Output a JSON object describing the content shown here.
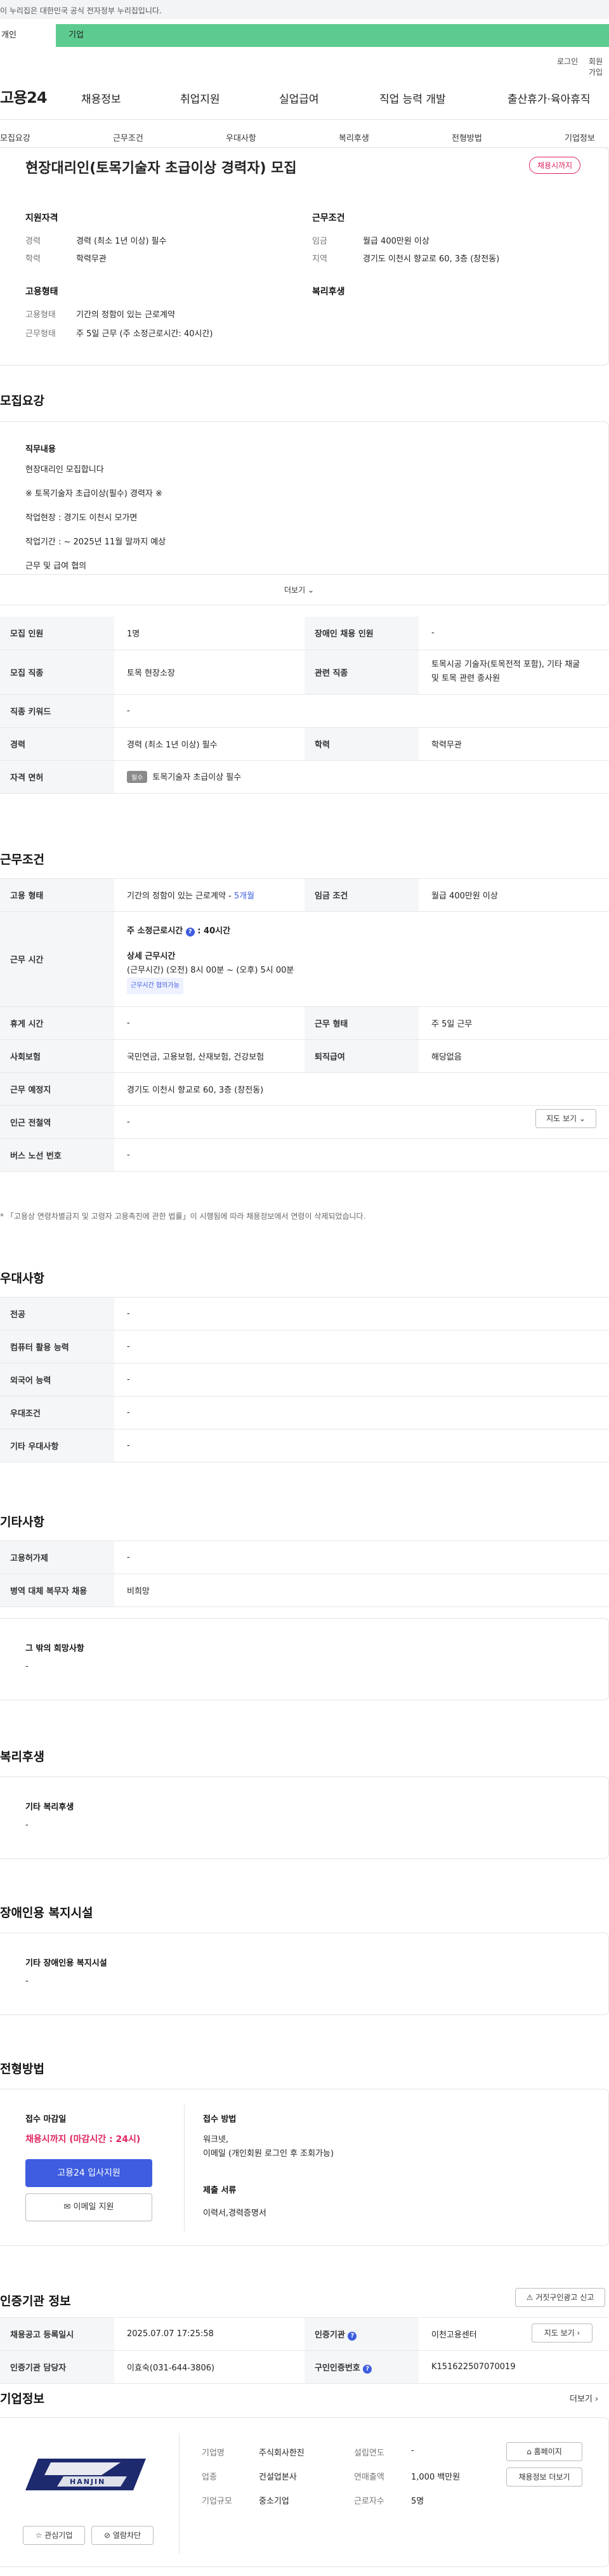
{
  "gov_banner": {
    "text": "이 누리집은 대한민국 공식 전자정부 누리집입니다."
  },
  "audience_tabs": {
    "private": "개인",
    "business": "기업"
  },
  "util": {
    "login": "로그인",
    "join": "회원가입"
  },
  "logo": "고용24",
  "gnb": [
    "채용정보",
    "취업지원",
    "실업급여",
    "직업 능력 개발",
    "출산휴가·육아휴직"
  ],
  "lnb": [
    "모집요강",
    "근무조건",
    "우대사항",
    "복리후생",
    "전형방법",
    "기업정보"
  ],
  "summary": {
    "title": "현장대리인(토목기술자 초급이상 경력자) 모집",
    "status_badge": "채용시까지",
    "qual_head": "지원자격",
    "career_k": "경력",
    "career_v": "경력 (최소 1년 이상) 필수",
    "edu_k": "학력",
    "edu_v": "학력무관",
    "cond_head": "근무조건",
    "wage_k": "임금",
    "wage_v": "월급 400만원 이상",
    "loc_k": "지역",
    "loc_v": "경기도 이천시 향교로 60, 3층 (창전동)",
    "emp_head": "고용형태",
    "type_k": "고용형태",
    "type_v": "기간의 정함이 있는 근로계약",
    "hours_k": "근무형태",
    "hours_v": "주 5일 근무 (주 소정근로시간: 40시간)",
    "welfare_head": "복리후생"
  },
  "recruit": {
    "heading": "모집요강",
    "duty_head": "직무내용",
    "lines": [
      "현장대리인 모집합니다",
      "※ 토목기술자 초급이상(필수) 경력자 ※",
      "작업현장 : 경기도 이천시 모가면",
      "작업기간 : ~ 2025년 11월 말까지 예상",
      "근무 및 급여 협의"
    ],
    "more": "더보기"
  },
  "recruit_table": {
    "count_k": "모집 인원",
    "count_v": "1명",
    "disabled_k": "장애인 채용 인원",
    "disabled_v": "-",
    "job_k": "모집 직종",
    "job_v": "토목 현장소장",
    "rel_k": "관련 직종",
    "rel_v1": "토목시공 기술자(토목전적 포함), 기타 채굴",
    "rel_v2": "및 토목 관련 종사원",
    "kw_k": "직종 키워드",
    "kw_v": "-",
    "career_k": "경력",
    "career_v": "경력 (최소 1년 이상) 필수",
    "edu_k": "학력",
    "edu_v": "학력무관",
    "license_k": "자격 면허",
    "license_tag": "필수",
    "license_v": "토목기술자 초급이상 필수"
  },
  "conditions": {
    "heading": "근무조건",
    "emp_k": "고용 형태",
    "emp_v": "기간의 정함이 있는 근로계약 - ",
    "emp_dur": "5개월",
    "wage_k": "임금 조건",
    "wage_v": "월급 400만원 이상",
    "hours_k": "근무 시간",
    "weekly_label": "주 소정근로시간",
    "weekly_val": ": 40시간",
    "detail_head": "상세 근무시간",
    "detail_v": "(근무시간) (오전) 8시 00분 ~ (오후) 5시 00분",
    "detail_chip": "근무시간 협의가능",
    "rest_k": "휴게 시간",
    "rest_v": "-",
    "form_k": "근무 형태",
    "form_v": "주 5일 근무",
    "ins_k": "사회보험",
    "ins_v": "국민연금, 고용보험, 산재보험, 건강보험",
    "sev_k": "퇴직급여",
    "sev_v": "해당없음",
    "place_k": "근무 예정지",
    "place_v": "경기도 이천시 향교로 60, 3층 (창전동)",
    "map_btn": "지도 보기",
    "subway_k": "인근 전철역",
    "subway_v": "-",
    "bus_k": "버스 노선 번호",
    "bus_v": "-",
    "note": "* 「고용상 연령차별금지 및 고령자 고용촉진에 관한 법률」이 시행됨에 따라 채용정보에서 연령이 삭제되었습니다."
  },
  "preference": {
    "heading": "우대사항",
    "rows": [
      {
        "k": "전공",
        "v": "-"
      },
      {
        "k": "컴퓨터 활용 능력",
        "v": "-"
      },
      {
        "k": "외국어 능력",
        "v": "-"
      },
      {
        "k": "우대조건",
        "v": "-"
      },
      {
        "k": "기타 우대사항",
        "v": "-"
      }
    ]
  },
  "other": {
    "heading": "기타사항",
    "rows": [
      {
        "k": "고용허가제",
        "v": "-"
      },
      {
        "k": "병역 대체 복무자 채용",
        "v": "비희망"
      }
    ],
    "extra_head": "그 밖의 희망사항",
    "extra_v": "-"
  },
  "welfare": {
    "heading": "복리후생",
    "sub": "기타 복리후생",
    "v": "-"
  },
  "disability": {
    "heading": "장애인용 복지시설",
    "sub": "기타 장애인용 복지시설",
    "v": "-"
  },
  "selection": {
    "heading": "전형방법",
    "deadline_head": "접수 마감일",
    "deadline_v": "채용시까지 (마감시간 : 24시)",
    "apply_btn": "고용24 입사지원",
    "email_btn": "이메일 지원",
    "method_head": "접수 방법",
    "method_v1": "워크넷,",
    "method_v2": "이메일 (개인회원 로그인 후 조회가능)",
    "docs_head": "제출 서류",
    "docs_v": "이력서,경력증명서"
  },
  "agency": {
    "heading": "인증기관 정보",
    "report_btn": "거짓구인광고 신고",
    "reg_k": "채용공고 등록일시",
    "reg_v": "2025.07.07 17:25:58",
    "org_k": "인증기관",
    "org_v": "이천고용센터",
    "map_btn": "지도 보기",
    "mgr_k": "인증기관 담당자",
    "mgr_v": "이효숙(031-644-3806)",
    "no_k": "구인인증번호",
    "no_v": "K151622507070019"
  },
  "company": {
    "heading": "기업정보",
    "more": "더보기",
    "logo_text": "HANJIN",
    "name_k": "기업명",
    "name_v": "주식회사한진",
    "industry_k": "업종",
    "industry_v": "건설업본사",
    "size_k": "기업규모",
    "size_v": "중소기업",
    "founded_k": "설립연도",
    "founded_v": "-",
    "sales_k": "연매출액",
    "sales_v": "1,000 백만원",
    "staff_k": "근로자수",
    "staff_v": "5명",
    "home_btn": "홈페이지",
    "jobs_btn": "채용정보 더보기",
    "fav_btn": "관심기업",
    "block_btn": "열람차단"
  }
}
